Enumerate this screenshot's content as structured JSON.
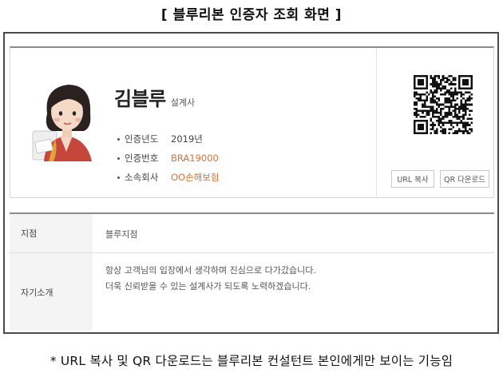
{
  "page_title": "[ 블루리본 인증자 조회 화면 ]",
  "profile": {
    "name": "김블루",
    "role": "설계사",
    "fields": [
      {
        "label": "인증년도",
        "value": "2019년",
        "accent": false
      },
      {
        "label": "인증번호",
        "value": "BRA19000",
        "accent": true
      },
      {
        "label": "소속회사",
        "value": "OO손해보험",
        "accent": true
      }
    ],
    "accent_color": "#d9723a"
  },
  "actions": {
    "url_copy_label": "URL 복사",
    "qr_download_label": "QR 다운로드"
  },
  "details": {
    "branch_label": "지점",
    "branch_value": "블루지점",
    "intro_label": "자기소개",
    "intro_lines": [
      "항상 고객님의 입장에서 생각하며 진심으로 다가갔습니다.",
      "더욱 신뢰받을 수 있는 설계사가 되도록 노력하겠습니다."
    ]
  },
  "footnote": "* URL 복사 및 QR 다운로드는 블루리본 컨설턴트 본인에게만 보이는 기능임"
}
